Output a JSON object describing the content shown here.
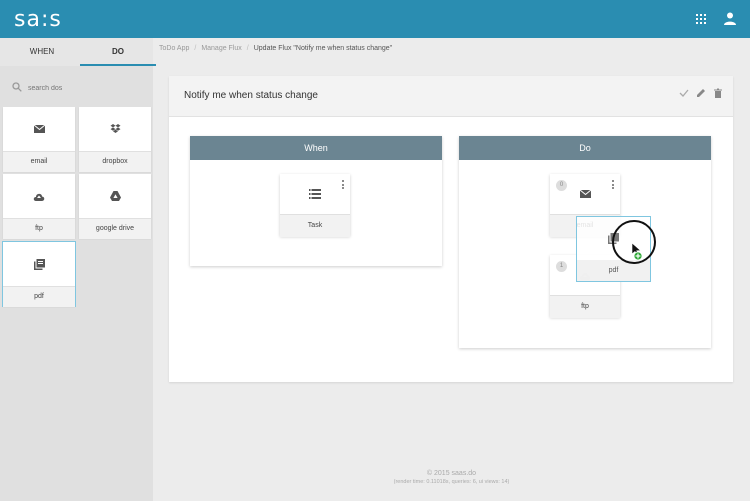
{
  "app": {
    "logo": "sa:s"
  },
  "sidebar": {
    "tabs": [
      {
        "label": "WHEN"
      },
      {
        "label": "DO"
      }
    ],
    "search_placeholder": "search dos",
    "items": [
      {
        "label": "email",
        "icon": "mail-icon"
      },
      {
        "label": "dropbox",
        "icon": "dropbox-icon"
      },
      {
        "label": "ftp",
        "icon": "cloud-upload-icon"
      },
      {
        "label": "google drive",
        "icon": "google-drive-icon"
      },
      {
        "label": "pdf",
        "icon": "pdf-icon"
      }
    ]
  },
  "breadcrumb": [
    "ToDo App",
    "Manage Flux",
    "Update Flux \"Notify me when status change\""
  ],
  "flux": {
    "title": "Notify me when status change",
    "when": {
      "heading": "When",
      "trigger": {
        "label": "Task"
      }
    },
    "do": {
      "heading": "Do",
      "actions": [
        {
          "order": "0",
          "label": "email"
        },
        {
          "order": "1",
          "label": "ftp"
        }
      ]
    },
    "dragging": {
      "label": "pdf"
    }
  },
  "footer": {
    "copyright": "© 2015 saas.do",
    "stats": "(render time: 0.11018s, queries: 6, ui views: 14)"
  },
  "colors": {
    "topbar": "#2a8db1",
    "box_header": "#6b8592",
    "accent": "#7fc6e0"
  }
}
